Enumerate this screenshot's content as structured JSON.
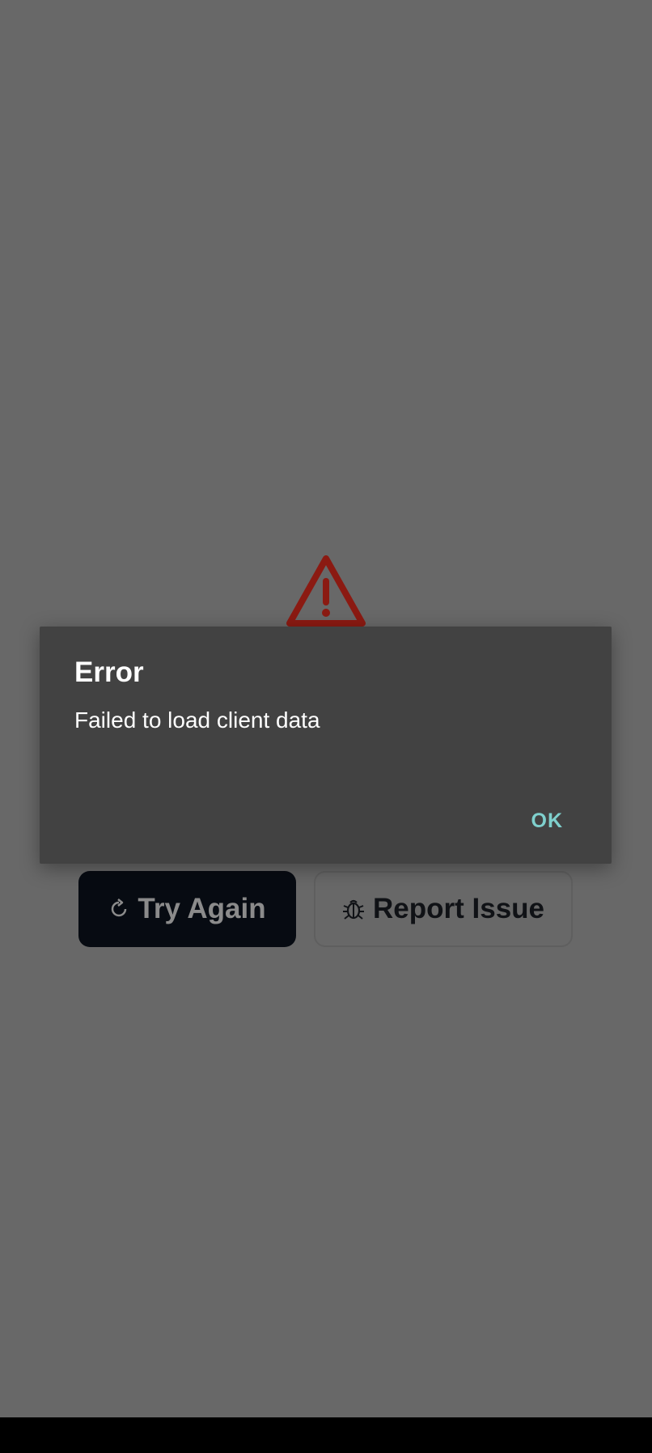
{
  "page": {
    "background_color": "#686868"
  },
  "error_page": {
    "icon": "warning-triangle-icon",
    "icon_color": "#8b1a12",
    "try_again": {
      "icon": "refresh-icon",
      "label": "Try Again"
    },
    "report_issue": {
      "icon": "bug-icon",
      "label": "Report Issue"
    }
  },
  "dialog": {
    "title": "Error",
    "message": "Failed to load client data",
    "ok_label": "OK",
    "accent_color": "#7fd0cd"
  }
}
